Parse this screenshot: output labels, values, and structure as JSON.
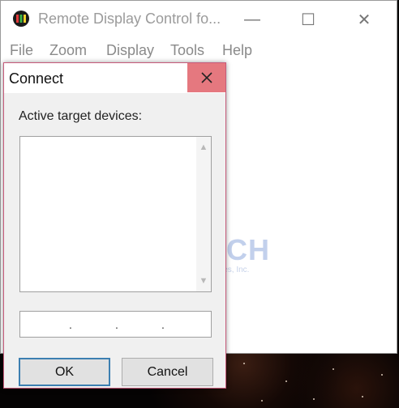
{
  "window": {
    "title": "Remote Display Control fo...",
    "controls": {
      "minimize": "—",
      "maximize": "☐",
      "close": "✕"
    }
  },
  "menubar": {
    "items": [
      "File",
      "Zoom",
      "Display",
      "Tools",
      "Help"
    ]
  },
  "dialog": {
    "title": "Connect",
    "close_icon": "close-icon",
    "list_label": "Active target devices:",
    "devices": [],
    "ip_value": ". . .",
    "ok_label": "OK",
    "cancel_label": "Cancel"
  },
  "watermark": {
    "logo": "KOSTECH",
    "subtitle": "Korea System Technologies, Inc."
  },
  "colors": {
    "dialog_close_bg": "#e5787f",
    "dialog_border": "#c65a7a",
    "default_button_border": "#3c7fb1"
  }
}
